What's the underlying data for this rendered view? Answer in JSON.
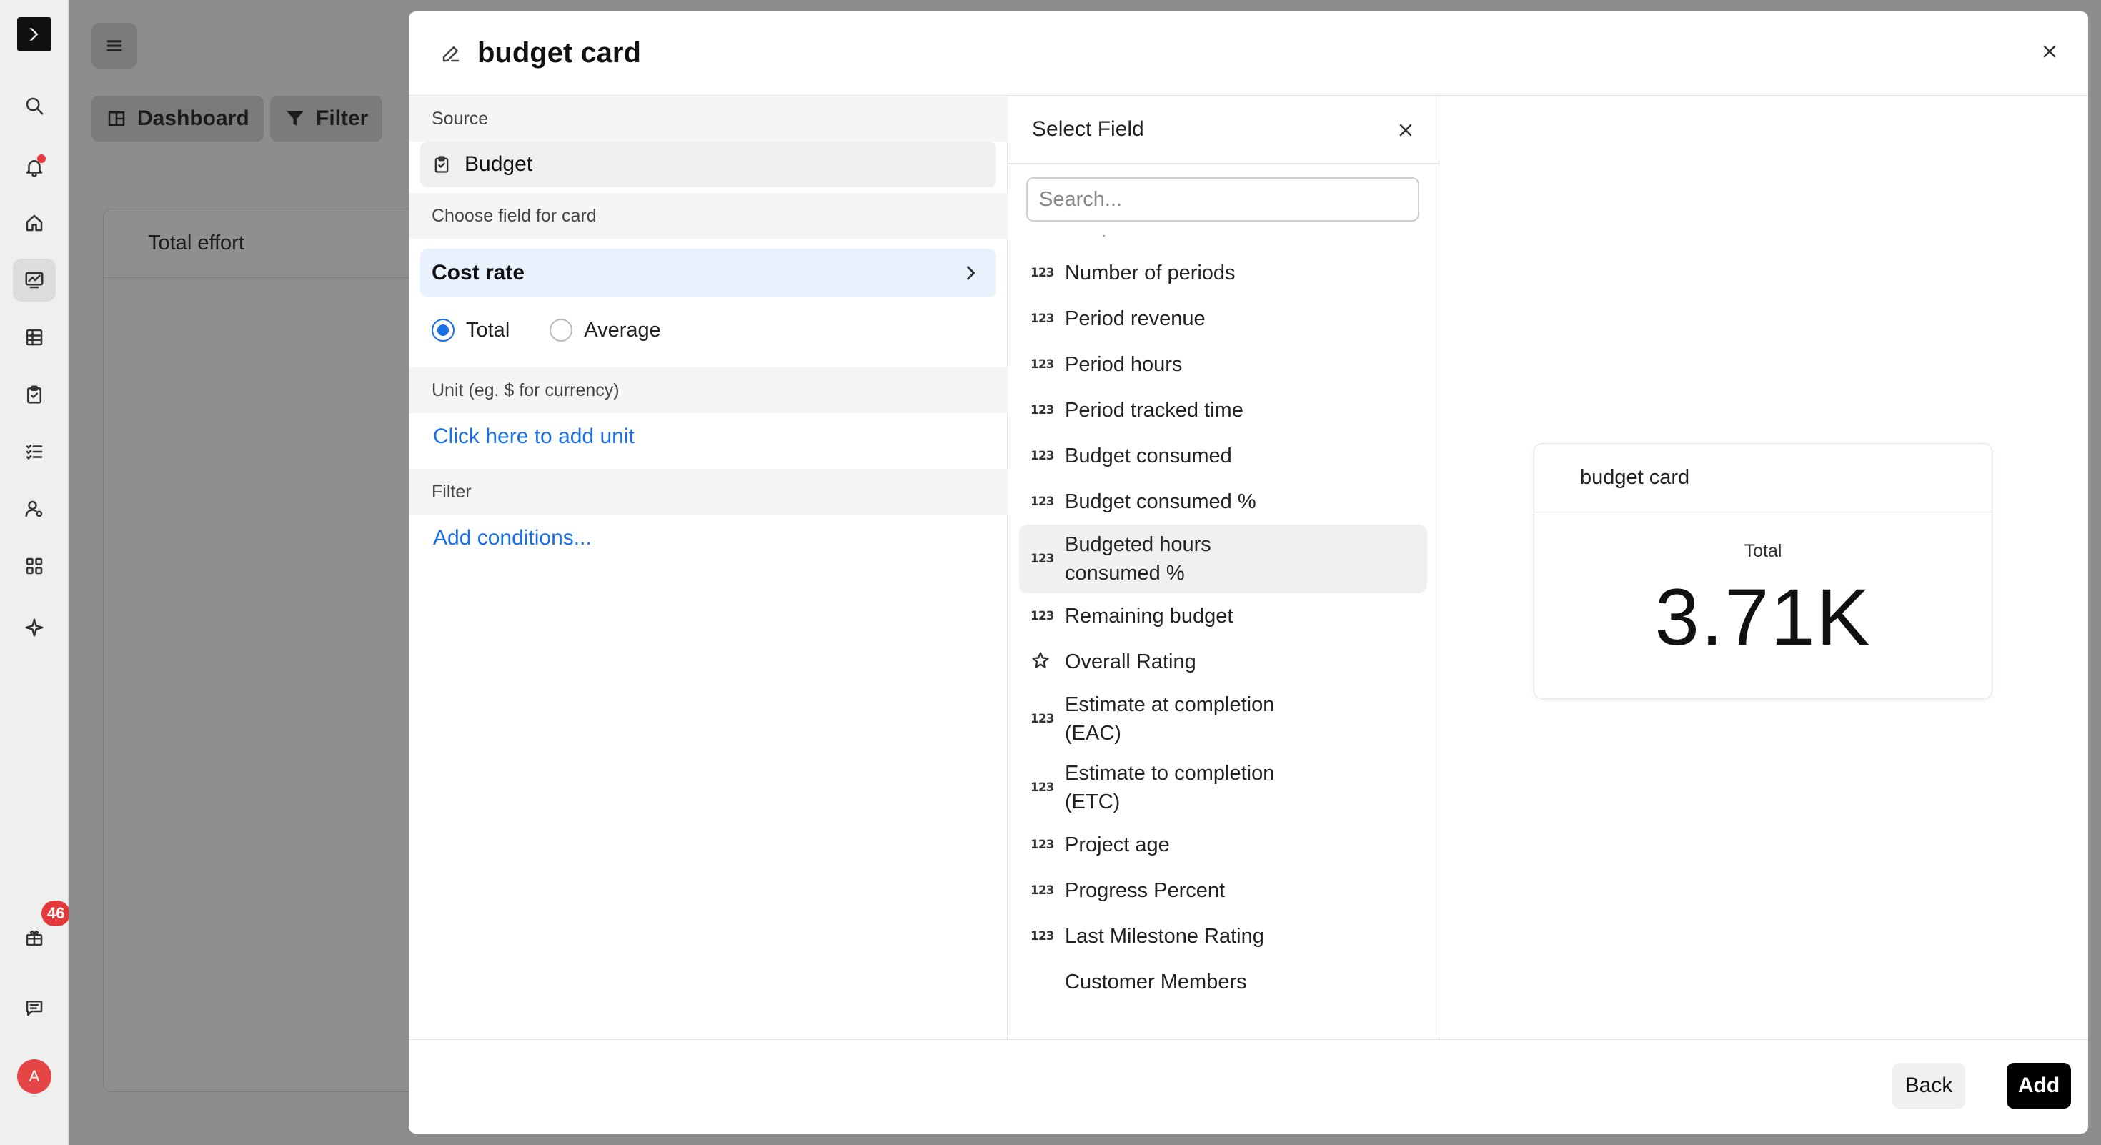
{
  "rail": {
    "icons": [
      "logo-icon",
      "search-icon",
      "bell-icon",
      "home-icon",
      "dashboard-icon",
      "table-icon",
      "clipboard-icon",
      "checklist-icon",
      "user-settings-icon",
      "apps-icon",
      "sparkle-icon",
      "gift-icon",
      "chat-icon"
    ],
    "gift_badge": "46",
    "avatar_initial": "A"
  },
  "background": {
    "dashboard_label": "Dashboard",
    "filter_label": "Filter",
    "card_title": "Total effort"
  },
  "modal": {
    "title": "budget card",
    "source_label": "Source",
    "source_value": "Budget",
    "choose_field_label": "Choose field for card",
    "chosen_field": "Cost rate",
    "aggregation": {
      "options": [
        "Total",
        "Average"
      ],
      "selected": "Total"
    },
    "unit_label": "Unit (eg. $ for currency)",
    "unit_link": "Click here to add unit",
    "filter_label": "Filter",
    "filter_link": "Add conditions...",
    "back_label": "Back",
    "add_label": "Add"
  },
  "select_field": {
    "title": "Select Field",
    "search_placeholder": "Search...",
    "items": [
      {
        "label": "Number of periods",
        "icon": "123"
      },
      {
        "label": "Period revenue",
        "icon": "123"
      },
      {
        "label": "Period hours",
        "icon": "123"
      },
      {
        "label": "Period tracked time",
        "icon": "123"
      },
      {
        "label": "Budget consumed",
        "icon": "123"
      },
      {
        "label": "Budget consumed %",
        "icon": "123"
      },
      {
        "label": "Budgeted hours consumed %",
        "icon": "123"
      },
      {
        "label": "Remaining budget",
        "icon": "123"
      },
      {
        "label": "Overall Rating",
        "icon": "star"
      },
      {
        "label": "Estimate at completion (EAC)",
        "icon": "123"
      },
      {
        "label": "Estimate to completion (ETC)",
        "icon": "123"
      },
      {
        "label": "Project age",
        "icon": "123"
      },
      {
        "label": "Progress Percent",
        "icon": "123"
      },
      {
        "label": "Last Milestone Rating",
        "icon": "123"
      },
      {
        "label": "Customer Members",
        "icon": ""
      }
    ],
    "highlighted_index": 6
  },
  "preview": {
    "card_title": "budget card",
    "metric_label": "Total",
    "metric_value": "3.71K"
  },
  "colors": {
    "accent": "#1a6fe6",
    "badge": "#e5383b",
    "primary_button": "#000000"
  }
}
